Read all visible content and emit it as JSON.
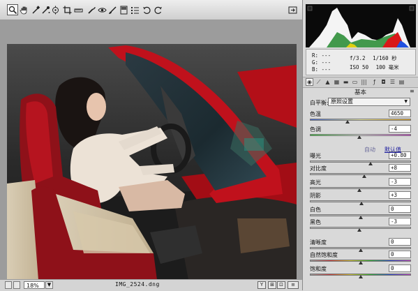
{
  "toolbar": {
    "tools": [
      {
        "name": "zoom-tool-icon"
      },
      {
        "name": "hand-tool-icon"
      },
      {
        "name": "white-balance-tool-icon"
      },
      {
        "name": "color-sampler-tool-icon"
      },
      {
        "name": "target-adjustment-tool-icon"
      },
      {
        "name": "crop-tool-icon"
      },
      {
        "name": "straighten-tool-icon"
      },
      {
        "name": "spot-removal-tool-icon"
      },
      {
        "name": "red-eye-tool-icon"
      },
      {
        "name": "adjustment-brush-icon"
      },
      {
        "name": "graduated-filter-icon"
      },
      {
        "name": "open-preferences-icon"
      },
      {
        "name": "rotate-left-icon"
      },
      {
        "name": "rotate-right-icon"
      },
      {
        "name": "toggle-fullscreen-icon"
      }
    ]
  },
  "status": {
    "zoom": "18%",
    "filename": "IMG_2524.dng"
  },
  "info": {
    "r": "R:  ---",
    "g": "G:  ---",
    "b": "B:  ---",
    "aperture": "f/3.2",
    "shutter": "1/160 秒",
    "iso": "ISO 50",
    "focal": "100 毫米"
  },
  "panel": {
    "section_title": "基本",
    "wb_label": "白平衡:",
    "wb_value": "原照设置",
    "auto_label": "自动",
    "default_label": "默认值",
    "rows": [
      {
        "label": "色温",
        "value": "4650",
        "level": 0.37
      },
      {
        "label": "色调",
        "value": "-4",
        "level": 0.49
      },
      {
        "label": "曝光",
        "value": "+0.80",
        "level": 0.6
      },
      {
        "label": "对比度",
        "value": "+8",
        "level": 0.54
      },
      {
        "label": "高光",
        "value": "-3",
        "level": 0.49
      },
      {
        "label": "阴影",
        "value": "+3",
        "level": 0.51
      },
      {
        "label": "白色",
        "value": "0",
        "level": 0.5
      },
      {
        "label": "黑色",
        "value": "-3",
        "level": 0.49
      },
      {
        "label": "清晰度",
        "value": "0",
        "level": 0.5
      },
      {
        "label": "自然饱和度",
        "value": "0",
        "level": 0.5
      },
      {
        "label": "饱和度",
        "value": "0",
        "level": 0.5
      }
    ]
  },
  "colors": {
    "car_red": "#c0111c",
    "panel_bg": "#d9d9d9",
    "canvas_bg": "#9c9c9c"
  }
}
